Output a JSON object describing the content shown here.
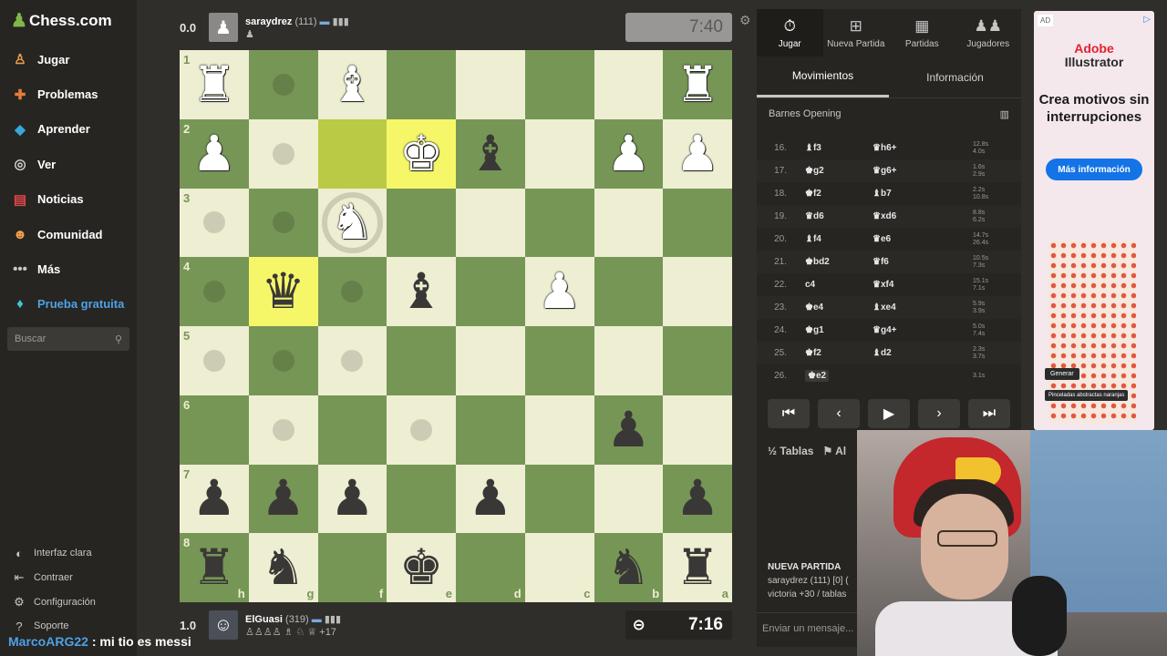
{
  "brand": {
    "name": "Chess.com"
  },
  "sidebar": {
    "items": [
      {
        "label": "Jugar",
        "icon": "play-icon"
      },
      {
        "label": "Problemas",
        "icon": "puzzle-icon"
      },
      {
        "label": "Aprender",
        "icon": "learn-icon"
      },
      {
        "label": "Ver",
        "icon": "binoculars-icon"
      },
      {
        "label": "Noticias",
        "icon": "news-icon"
      },
      {
        "label": "Comunidad",
        "icon": "community-icon"
      },
      {
        "label": "Más",
        "icon": "more-icon"
      },
      {
        "label": "Prueba gratuita",
        "icon": "diamond-icon"
      }
    ],
    "search_placeholder": "Buscar",
    "bottom": [
      {
        "label": "Interfaz clara",
        "icon": "contrast-icon"
      },
      {
        "label": "Contraer",
        "icon": "collapse-icon"
      },
      {
        "label": "Configuración",
        "icon": "gear-icon"
      },
      {
        "label": "Soporte",
        "icon": "help-icon"
      }
    ]
  },
  "top_player": {
    "score": "0.0",
    "name": "saraydrez",
    "rating": "(111)",
    "clock": "7:40"
  },
  "bottom_player": {
    "score": "1.0",
    "name": "ElGuasi",
    "rating": "(319)",
    "captured_advantage": "+17",
    "clock": "7:16"
  },
  "board": {
    "ranks": [
      "1",
      "2",
      "3",
      "4",
      "5",
      "6",
      "7",
      "8"
    ],
    "files": [
      "h",
      "g",
      "f",
      "e",
      "d",
      "c",
      "b",
      "a"
    ],
    "pieces": [
      [
        "wR",
        "",
        "wB",
        "",
        "",
        "",
        "",
        "wR"
      ],
      [
        "wP",
        "",
        "",
        "wK",
        "bB",
        "",
        "wP",
        "wP"
      ],
      [
        "",
        "",
        "wN",
        "",
        "",
        "",
        "",
        ""
      ],
      [
        "",
        "bQ",
        "",
        "bB",
        "",
        "wP",
        "",
        ""
      ],
      [
        "",
        "",
        "",
        "",
        "",
        "",
        "",
        ""
      ],
      [
        "",
        "",
        "",
        "",
        "",
        "",
        "bP",
        ""
      ],
      [
        "bP",
        "bP",
        "bP",
        "",
        "bP",
        "",
        "",
        "bP"
      ],
      [
        "bR",
        "bN",
        "",
        "bK",
        "",
        "",
        "bN",
        "bR"
      ]
    ],
    "highlights": [
      [
        1,
        2
      ],
      [
        1,
        3
      ],
      [
        3,
        1
      ]
    ],
    "dots": [
      [
        0,
        1
      ],
      [
        1,
        1
      ],
      [
        2,
        0
      ],
      [
        2,
        1
      ],
      [
        3,
        0
      ],
      [
        3,
        2
      ],
      [
        4,
        0
      ],
      [
        4,
        1
      ],
      [
        4,
        2
      ],
      [
        5,
        1
      ],
      [
        5,
        3
      ]
    ],
    "rings": [
      [
        2,
        2
      ]
    ]
  },
  "panel": {
    "tabs": [
      {
        "label": "Jugar",
        "icon": "stopwatch-icon"
      },
      {
        "label": "Nueva Partida",
        "icon": "plus-icon"
      },
      {
        "label": "Partidas",
        "icon": "board-icon"
      },
      {
        "label": "Jugadores",
        "icon": "players-icon"
      }
    ],
    "subtabs": [
      "Movimientos",
      "Información"
    ],
    "opening": "Barnes Opening",
    "moves": [
      {
        "n": "16.",
        "w": "♝f3",
        "b": "♛h6+",
        "t1": "12.8s",
        "t2": "4.0s"
      },
      {
        "n": "17.",
        "w": "♚g2",
        "b": "♛g6+",
        "t1": "1.6s",
        "t2": "2.9s"
      },
      {
        "n": "18.",
        "w": "♚f2",
        "b": "♝b7",
        "t1": "2.2s",
        "t2": "10.8s"
      },
      {
        "n": "19.",
        "w": "♛d6",
        "b": "♛xd6",
        "t1": "8.8s",
        "t2": "6.2s"
      },
      {
        "n": "20.",
        "w": "♝f4",
        "b": "♛e6",
        "t1": "14.7s",
        "t2": "26.4s"
      },
      {
        "n": "21.",
        "w": "♚bd2",
        "b": "♛f6",
        "t1": "10.5s",
        "t2": "7.3s"
      },
      {
        "n": "22.",
        "w": "c4",
        "b": "♛xf4",
        "t1": "15.1s",
        "t2": "7.1s"
      },
      {
        "n": "23.",
        "w": "♚e4",
        "b": "♝xe4",
        "t1": "5.9s",
        "t2": "3.9s"
      },
      {
        "n": "24.",
        "w": "♚g1",
        "b": "♛g4+",
        "t1": "5.0s",
        "t2": "7.4s"
      },
      {
        "n": "25.",
        "w": "♚f2",
        "b": "♝d2",
        "t1": "2.3s",
        "t2": "3.7s"
      },
      {
        "n": "26.",
        "w": "♚e2",
        "b": "",
        "t1": "3.1s",
        "t2": ""
      }
    ],
    "controls": [
      "⏮",
      "‹",
      "▶",
      "›",
      "⏭"
    ],
    "draw_label": "Tablas",
    "abort_label": "Al",
    "chat": {
      "title": "NUEVA PARTIDA",
      "line1": "saraydrez (111) [0] (",
      "line2": "victoria +30 / tablas",
      "input_placeholder": "Enviar un mensaje..."
    }
  },
  "ad": {
    "badge": "AD",
    "brand_line1": "Adobe",
    "brand_line2": "Illustrator",
    "headline": "Crea motivos sin interrupciones",
    "button": "Más información",
    "ui_label": "Generar",
    "ui_label2": "Pinceladas abstractas naranjas"
  },
  "stream_chat": {
    "user": "MarcoARG22",
    "message": ": mi tio es messi"
  },
  "colors": {
    "light_square": "#eeeed2",
    "dark_square": "#769656",
    "accent": "#81b64c",
    "link": "#4ea1e6"
  }
}
